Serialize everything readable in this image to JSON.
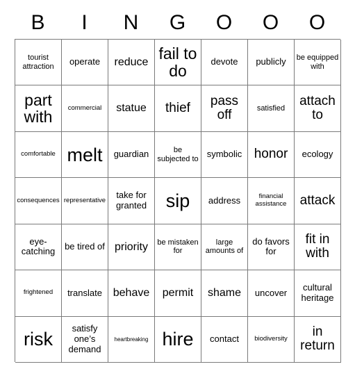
{
  "card": {
    "title": "Bingo Card",
    "columns": 7,
    "rows": 7,
    "grid_line_color": "#7a7a7a",
    "text_color": "#000000",
    "background_color": "#ffffff"
  },
  "header": {
    "letters": [
      "B",
      "I",
      "N",
      "G",
      "O",
      "O",
      "O"
    ]
  },
  "cells": [
    {
      "text": "tourist attraction",
      "size": "fs-s"
    },
    {
      "text": "operate",
      "size": "fs-m"
    },
    {
      "text": "reduce",
      "size": "fs-l"
    },
    {
      "text": "fail to do",
      "size": "fs-xxl"
    },
    {
      "text": "devote",
      "size": "fs-m"
    },
    {
      "text": "publicly",
      "size": "fs-m"
    },
    {
      "text": "be equipped with",
      "size": "fs-s"
    },
    {
      "text": "part with",
      "size": "fs-xxl"
    },
    {
      "text": "commercial",
      "size": "fs-xs"
    },
    {
      "text": "statue",
      "size": "fs-l"
    },
    {
      "text": "thief",
      "size": "fs-xl"
    },
    {
      "text": "pass off",
      "size": "fs-xl"
    },
    {
      "text": "satisfied",
      "size": "fs-s"
    },
    {
      "text": "attach to",
      "size": "fs-xl"
    },
    {
      "text": "comfortable",
      "size": "fs-xs"
    },
    {
      "text": "melt",
      "size": "fs-hug"
    },
    {
      "text": "guardian",
      "size": "fs-m"
    },
    {
      "text": "be subjected to",
      "size": "fs-s"
    },
    {
      "text": "symbolic",
      "size": "fs-m"
    },
    {
      "text": "honor",
      "size": "fs-xl"
    },
    {
      "text": "ecology",
      "size": "fs-m"
    },
    {
      "text": "consequences",
      "size": "fs-xs"
    },
    {
      "text": "representative",
      "size": "fs-xs"
    },
    {
      "text": "take for granted",
      "size": "fs-m"
    },
    {
      "text": "sip",
      "size": "fs-hug"
    },
    {
      "text": "address",
      "size": "fs-m"
    },
    {
      "text": "financial assistance",
      "size": "fs-xs"
    },
    {
      "text": "attack",
      "size": "fs-xl"
    },
    {
      "text": "eye-catching",
      "size": "fs-m"
    },
    {
      "text": "be tired of",
      "size": "fs-m"
    },
    {
      "text": "priority",
      "size": "fs-l"
    },
    {
      "text": "be mistaken for",
      "size": "fs-s"
    },
    {
      "text": "large amounts of",
      "size": "fs-s"
    },
    {
      "text": "do favors for",
      "size": "fs-m"
    },
    {
      "text": "fit in with",
      "size": "fs-xl"
    },
    {
      "text": "frightened",
      "size": "fs-xs"
    },
    {
      "text": "translate",
      "size": "fs-m"
    },
    {
      "text": "behave",
      "size": "fs-l"
    },
    {
      "text": "permit",
      "size": "fs-l"
    },
    {
      "text": "shame",
      "size": "fs-l"
    },
    {
      "text": "uncover",
      "size": "fs-m"
    },
    {
      "text": "cultural heritage",
      "size": "fs-m"
    },
    {
      "text": "risk",
      "size": "fs-hug"
    },
    {
      "text": "satisfy one’s demand",
      "size": "fs-m"
    },
    {
      "text": "heartbreaking",
      "size": "fs-xxs"
    },
    {
      "text": "hire",
      "size": "fs-hug"
    },
    {
      "text": "contact",
      "size": "fs-m"
    },
    {
      "text": "biodiversity",
      "size": "fs-xs"
    },
    {
      "text": "in return",
      "size": "fs-xl"
    }
  ]
}
